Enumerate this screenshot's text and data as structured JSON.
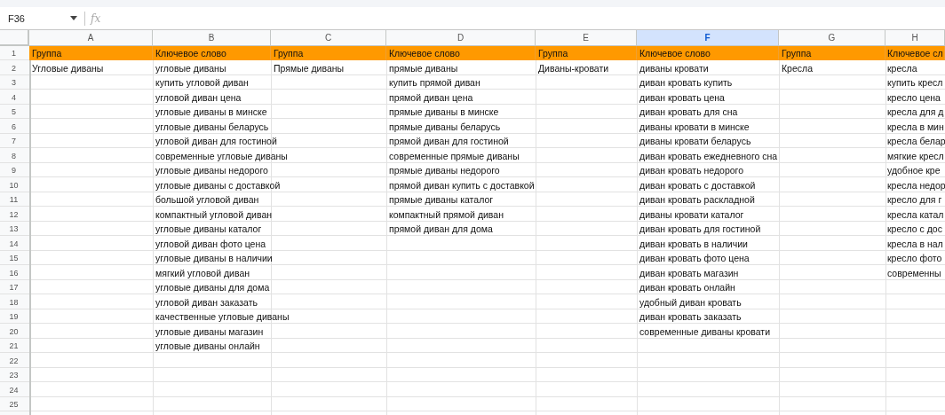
{
  "formula_bar": {
    "cell_reference": "F36",
    "function_label": "fx"
  },
  "columns": [
    {
      "letter": "A",
      "selected": false
    },
    {
      "letter": "B",
      "selected": false
    },
    {
      "letter": "C",
      "selected": false
    },
    {
      "letter": "D",
      "selected": false
    },
    {
      "letter": "E",
      "selected": false
    },
    {
      "letter": "F",
      "selected": true
    },
    {
      "letter": "G",
      "selected": false
    },
    {
      "letter": "H",
      "selected": false
    }
  ],
  "rows": [
    {
      "number": "1",
      "kind": "header",
      "cells": {
        "A": "Группа",
        "B": "Ключевое слово",
        "C": "Группа",
        "D": "Ключевое слово",
        "E": "Группа",
        "F": "Ключевое слово",
        "G": "Группа",
        "H": "Ключевое сл"
      }
    },
    {
      "number": "2",
      "kind": "data",
      "cells": {
        "A": "Угловые диваны",
        "B": "угловые диваны",
        "C": "Прямые диваны",
        "D": "прямые диваны",
        "E": "Диваны-кровати",
        "F": "диваны кровати",
        "G": "Кресла",
        "H": "кресла"
      }
    },
    {
      "number": "3",
      "kind": "data",
      "cells": {
        "B": "купить угловой диван",
        "D": "купить прямой диван",
        "F": "диван кровать купить",
        "H": "купить кресл"
      }
    },
    {
      "number": "4",
      "kind": "data",
      "cells": {
        "B": "угловой диван цена",
        "D": "прямой диван цена",
        "F": "диван кровать цена",
        "H": "кресло цена"
      }
    },
    {
      "number": "5",
      "kind": "data",
      "cells": {
        "B": "угловые диваны в минске",
        "D": "прямые диваны в минске",
        "F": "диван кровать для сна",
        "H": "кресла для д"
      }
    },
    {
      "number": "6",
      "kind": "data",
      "cells": {
        "B": "угловые диваны беларусь",
        "D": "прямые диваны беларусь",
        "F": "диваны кровати в минске",
        "H": "кресла в мин"
      }
    },
    {
      "number": "7",
      "kind": "data",
      "cells": {
        "B": "угловой диван для гостиной",
        "D": "прямой диван для гостиной",
        "F": "диваны кровати беларусь",
        "H": "кресла белар"
      }
    },
    {
      "number": "8",
      "kind": "data",
      "cells": {
        "B": "современные угловые диваны",
        "D": "современные прямые диваны",
        "F": "диван кровать ежедневного сна",
        "H": "мягкие кресл"
      }
    },
    {
      "number": "9",
      "kind": "data",
      "cells": {
        "B": "угловые диваны недорого",
        "D": "прямые диваны недорого",
        "F": "диван кровать недорого",
        "H": "удобное кре"
      }
    },
    {
      "number": "10",
      "kind": "data",
      "cells": {
        "B": "угловые диваны с доставкой",
        "D": "прямой диван купить с доставкой",
        "F": "диван кровать с доставкой",
        "H": "кресла недор"
      }
    },
    {
      "number": "11",
      "kind": "data",
      "cells": {
        "B": "большой угловой диван",
        "D": "прямые диваны каталог",
        "F": "диван кровать раскладной",
        "H": "кресло для г"
      }
    },
    {
      "number": "12",
      "kind": "data",
      "cells": {
        "B": "компактный угловой диван",
        "D": "компактный прямой диван",
        "F": "диваны кровати каталог",
        "H": "кресла катал"
      }
    },
    {
      "number": "13",
      "kind": "data",
      "cells": {
        "B": "угловые диваны каталог",
        "D": "прямой диван для дома",
        "F": "диван кровать для гостиной",
        "H": "кресло с дос"
      }
    },
    {
      "number": "14",
      "kind": "data",
      "cells": {
        "B": "угловой диван фото цена",
        "F": "диван кровать в наличии",
        "H": "кресла в нал"
      }
    },
    {
      "number": "15",
      "kind": "data",
      "cells": {
        "B": "угловые диваны в наличии",
        "F": "диван кровать фото цена",
        "H": "кресло фото"
      }
    },
    {
      "number": "16",
      "kind": "data",
      "cells": {
        "B": "мягкий угловой диван",
        "F": "диван кровать магазин",
        "H": "современны"
      }
    },
    {
      "number": "17",
      "kind": "data",
      "cells": {
        "B": "угловые диваны для дома",
        "F": "диван кровать онлайн"
      }
    },
    {
      "number": "18",
      "kind": "data",
      "cells": {
        "B": "угловой диван заказать",
        "F": "удобный диван кровать"
      }
    },
    {
      "number": "19",
      "kind": "data",
      "cells": {
        "B": "качественные угловые диваны",
        "F": "диван кровать заказать"
      }
    },
    {
      "number": "20",
      "kind": "data",
      "cells": {
        "B": "угловые диваны магазин",
        "F": "современные диваны кровати"
      }
    },
    {
      "number": "21",
      "kind": "data",
      "cells": {
        "B": "угловые диваны онлайн"
      }
    },
    {
      "number": "22",
      "kind": "data"
    },
    {
      "number": "23",
      "kind": "data"
    },
    {
      "number": "24",
      "kind": "data"
    },
    {
      "number": "25",
      "kind": "data"
    }
  ]
}
